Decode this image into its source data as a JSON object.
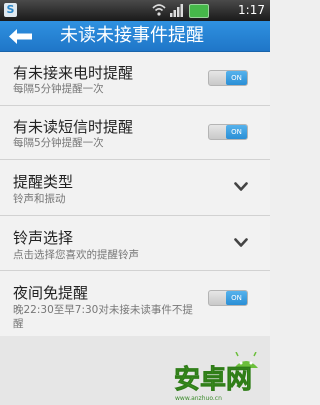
{
  "status_bar": {
    "time": "1:17",
    "icons": [
      "app-icon",
      "wifi-icon",
      "signal-icon",
      "battery-icon"
    ],
    "app_icon_label": "S"
  },
  "title_bar": {
    "title": "未读未接事件提醒",
    "back_icon": "back-arrow-icon",
    "accent_color": "#2887d6"
  },
  "settings": [
    {
      "label": "有未接来电时提醒",
      "desc": "每隔5分钟提醒一次",
      "control": "toggle",
      "toggle_text": "ON"
    },
    {
      "label": "有未读短信时提醒",
      "desc": "每隔5分钟提醒一次",
      "control": "toggle",
      "toggle_text": "ON"
    },
    {
      "label": "提醒类型",
      "desc": "铃声和振动",
      "control": "chevron"
    },
    {
      "label": "铃声选择",
      "desc": "点击选择您喜欢的提醒铃声",
      "control": "chevron"
    },
    {
      "label": "夜间免提醒",
      "desc": "晚22:30至早7:30对未接未读事件不提醒",
      "control": "toggle",
      "toggle_text": "ON"
    }
  ],
  "watermark": {
    "logo_text": "安卓网",
    "url": "www.anzhuo.cn"
  }
}
